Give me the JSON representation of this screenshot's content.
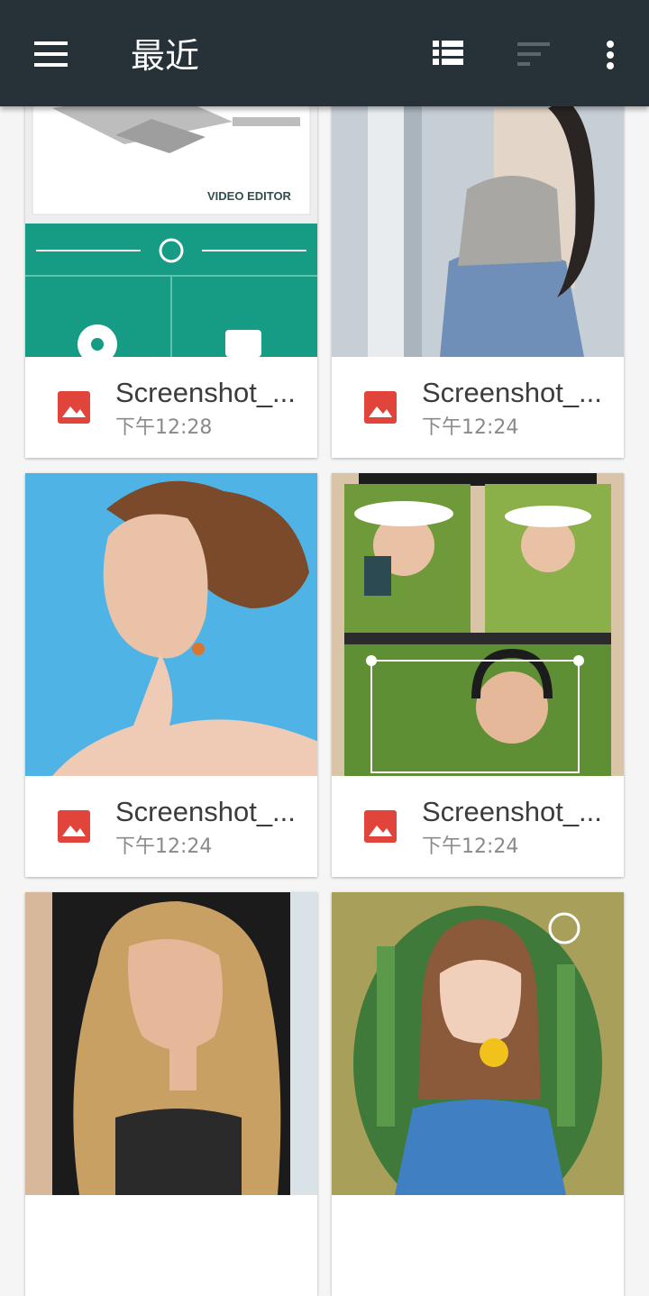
{
  "appbar": {
    "title": "最近",
    "icons": [
      "menu-icon",
      "view-list-icon",
      "sort-icon",
      "more-vert-icon"
    ]
  },
  "files": [
    {
      "name": "Screenshot_...",
      "time": "下午12:28",
      "thumb_text": "VIDEO EDITOR"
    },
    {
      "name": "Screenshot_...",
      "time": "下午12:24"
    },
    {
      "name": "Screenshot_...",
      "time": "下午12:24"
    },
    {
      "name": "Screenshot_...",
      "time": "下午12:24"
    },
    {
      "name": "",
      "time": ""
    },
    {
      "name": "",
      "time": ""
    }
  ],
  "colors": {
    "appbar": "#263238",
    "image_icon": "#e0443a",
    "teal": "#169b84",
    "background": "#f5f5f5"
  }
}
